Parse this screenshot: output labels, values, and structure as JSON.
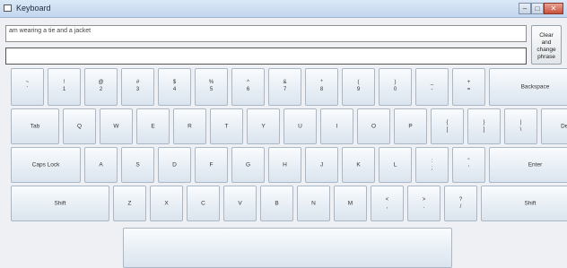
{
  "window": {
    "title": "Keyboard"
  },
  "phrase": "am wearing a tie and a jacket",
  "input_value": "",
  "clear_button": {
    "line1": "Clear",
    "line2": "and",
    "line3": "change",
    "line4": "phrase"
  },
  "rows": {
    "r1": [
      {
        "top": "~",
        "bot": "`"
      },
      {
        "top": "!",
        "bot": "1"
      },
      {
        "top": "@",
        "bot": "2"
      },
      {
        "top": "#",
        "bot": "3"
      },
      {
        "top": "$",
        "bot": "4"
      },
      {
        "top": "%",
        "bot": "5"
      },
      {
        "top": "^",
        "bot": "6"
      },
      {
        "top": "&",
        "bot": "7"
      },
      {
        "top": "*",
        "bot": "8"
      },
      {
        "top": "(",
        "bot": "9"
      },
      {
        "top": ")",
        "bot": "0"
      },
      {
        "top": "_",
        "bot": "-"
      },
      {
        "top": "+",
        "bot": "="
      },
      {
        "label": "Backspace"
      }
    ],
    "r2": [
      {
        "label": "Tab"
      },
      {
        "label": "Q"
      },
      {
        "label": "W"
      },
      {
        "label": "E"
      },
      {
        "label": "R"
      },
      {
        "label": "T"
      },
      {
        "label": "Y"
      },
      {
        "label": "U"
      },
      {
        "label": "I"
      },
      {
        "label": "O"
      },
      {
        "label": "P"
      },
      {
        "top": "{",
        "bot": "["
      },
      {
        "top": "}",
        "bot": "]"
      },
      {
        "top": "|",
        "bot": "\\"
      },
      {
        "label": "Del"
      }
    ],
    "r3": [
      {
        "label": "Caps Lock"
      },
      {
        "label": "A"
      },
      {
        "label": "S"
      },
      {
        "label": "D"
      },
      {
        "label": "F"
      },
      {
        "label": "G"
      },
      {
        "label": "H"
      },
      {
        "label": "J"
      },
      {
        "label": "K"
      },
      {
        "label": "L"
      },
      {
        "top": ":",
        "bot": ";"
      },
      {
        "top": "\"",
        "bot": "'"
      },
      {
        "label": "Enter"
      }
    ],
    "r4": [
      {
        "label": "Shift"
      },
      {
        "label": "Z"
      },
      {
        "label": "X"
      },
      {
        "label": "C"
      },
      {
        "label": "V"
      },
      {
        "label": "B"
      },
      {
        "label": "N"
      },
      {
        "label": "M"
      },
      {
        "top": "<",
        "bot": ","
      },
      {
        "top": ">",
        "bot": "."
      },
      {
        "top": "?",
        "bot": "/"
      },
      {
        "label": "Shift"
      }
    ],
    "r5": [
      {
        "label": ""
      }
    ]
  }
}
